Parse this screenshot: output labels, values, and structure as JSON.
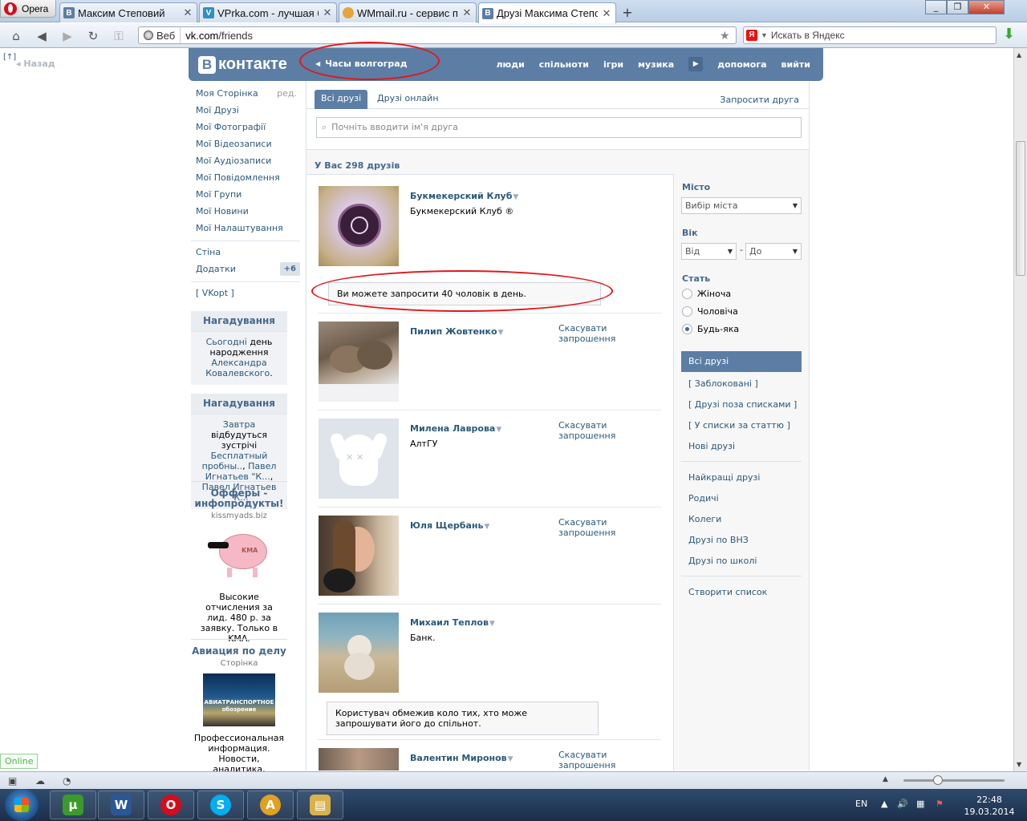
{
  "browser": {
    "menu_label": "Opera",
    "tabs": [
      {
        "title": "Максим Степовий",
        "fav": "В",
        "color": "#5c7ea4"
      },
      {
        "title": "VPrka.com - лучшая б...",
        "fav": "V",
        "color": "#2f8fc0"
      },
      {
        "title": "WMmail.ru - сервис п...",
        "fav": "",
        "color": "#e8a33a"
      },
      {
        "title": "Друзі Максима Степо...",
        "fav": "В",
        "color": "#5c7ea4"
      }
    ],
    "new_tab_icon": "+",
    "address": {
      "scheme_label": "Веб",
      "url_host": "vk.com",
      "url_path": "/friends"
    },
    "search_placeholder": "Искать в Яндекс",
    "search_engine_glyph": "Я"
  },
  "page_side": {
    "panel_label": "[↑]",
    "back_label": "Назад"
  },
  "vk": {
    "logo_letter": "В",
    "logo_text": "контакте",
    "status_text": "Часы волгоград",
    "nav": [
      "люди",
      "спільноти",
      "ігри",
      "музика",
      "допомога",
      "вийти"
    ]
  },
  "left_menu": {
    "items": [
      "Моя Сторінка",
      "Мої Друзі",
      "Мої Фотографії",
      "Мої Відеозаписи",
      "Мої Аудіозаписи",
      "Мої Повідомлення",
      "Мої Групи",
      "Мої Новини",
      "Мої Налаштування"
    ],
    "edit_label": "ред.",
    "wall_label": "Стіна",
    "apps_label": "Додатки",
    "apps_badge": "+6",
    "vkopt_label": "[ VKopt ]"
  },
  "reminders": [
    {
      "title": "Нагадування",
      "parts": [
        {
          "t": "Сьогодні",
          "link": true
        },
        {
          "t": " день народження ",
          "link": false
        },
        {
          "t": "Александра Ковалевского",
          "link": true
        },
        {
          "t": ".",
          "link": false
        }
      ]
    },
    {
      "title": "Нагадування",
      "parts": [
        {
          "t": "Завтра",
          "link": true
        },
        {
          "t": " відбудуться зустрічі ",
          "link": false
        },
        {
          "t": "Бесплатный пробны..",
          "link": true
        },
        {
          "t": ", ",
          "link": false
        },
        {
          "t": "Павел Игнатьев \"К...",
          "link": true
        },
        {
          "t": ", ",
          "link": false
        },
        {
          "t": "Павел Игнатьев \"К...",
          "link": true
        }
      ]
    }
  ],
  "ads": [
    {
      "title": "Офферы - инфопродукты!",
      "domain": "kissmyads.biz",
      "image_label": "KMA",
      "text": "Высокие отчисления за лид. 480 р. за заявку. Только в KMA."
    },
    {
      "title": "Авиация по делу",
      "domain": "Сторінка",
      "image_label": "АВИАТРАНСПОРТНОЕ обозрение",
      "text": "Профессиональная информация. Новости, аналитика,"
    }
  ],
  "friends_page": {
    "tabs": [
      "Всі друзі",
      "Друзі онлайн"
    ],
    "invite_label": "Запросити друга",
    "search_placeholder": "Почніть вводити ім'я друга",
    "count_label": "У Вас 298 друзів",
    "friends": [
      {
        "name": "Букмекерский Клуб",
        "sub": "Букмекерский Клуб ®",
        "cancel": "",
        "avatar": "club"
      },
      {
        "name": "Пилип Жовтенко",
        "sub": "",
        "cancel": "Скасувати запрошення",
        "avatar": "wolves"
      },
      {
        "name": "Милена Лаврова",
        "sub": "АлтГУ",
        "cancel": "Скасувати запрошення",
        "avatar": "dog"
      },
      {
        "name": "Юля Щербань",
        "sub": "",
        "cancel": "Скасувати запрошення",
        "avatar": "girl"
      },
      {
        "name": "Михаил Теплов",
        "sub": "Банк.",
        "cancel": "",
        "avatar": "bear"
      },
      {
        "name": "Валентин Миронов",
        "sub": "",
        "cancel": "Скасувати запрошення",
        "avatar": "man"
      }
    ],
    "limit_notice": "Ви можете запросити 40 чоловік в день.",
    "restrict_notice": "Користувач обмежив коло тих, хто може запрошувати його до спільнот."
  },
  "filters": {
    "city_label": "Місто",
    "city_select": "Вибір міста",
    "age_label": "Вік",
    "age_from": "Від",
    "age_to": "До",
    "age_dash": "-",
    "sex_label": "Стать",
    "sex_options": [
      "Жіноча",
      "Чоловіча",
      "Будь-яка"
    ],
    "sex_selected": 2,
    "lists_primary": [
      "Всі друзі",
      "[ Заблоковані ]",
      "[ Друзі поза списками ]",
      "[ У списки за статтю ]",
      "Нові друзі"
    ],
    "lists_secondary": [
      "Найкращі друзі",
      "Родичі",
      "Колеги",
      "Друзі по ВНЗ",
      "Друзі по школі"
    ],
    "create_list": "Створити список"
  },
  "status_bar": {
    "online_label": "Online"
  },
  "taskbar": {
    "apps": [
      {
        "label": "µ",
        "color": "#3b9a2c"
      },
      {
        "label": "W",
        "color": "#2b5797"
      },
      {
        "label": "O",
        "color": "#d50c1b"
      },
      {
        "label": "S",
        "color": "#00aff0"
      },
      {
        "label": "A",
        "color": "#e0a020"
      },
      {
        "label": "▤",
        "color": "#d8b24a"
      }
    ],
    "lang": "EN",
    "time": "22:48",
    "date": "19.03.2014"
  },
  "colors": {
    "vk_header": "#5c7ea4",
    "vk_link": "#2b587a",
    "annotation_red": "#e0171b"
  }
}
